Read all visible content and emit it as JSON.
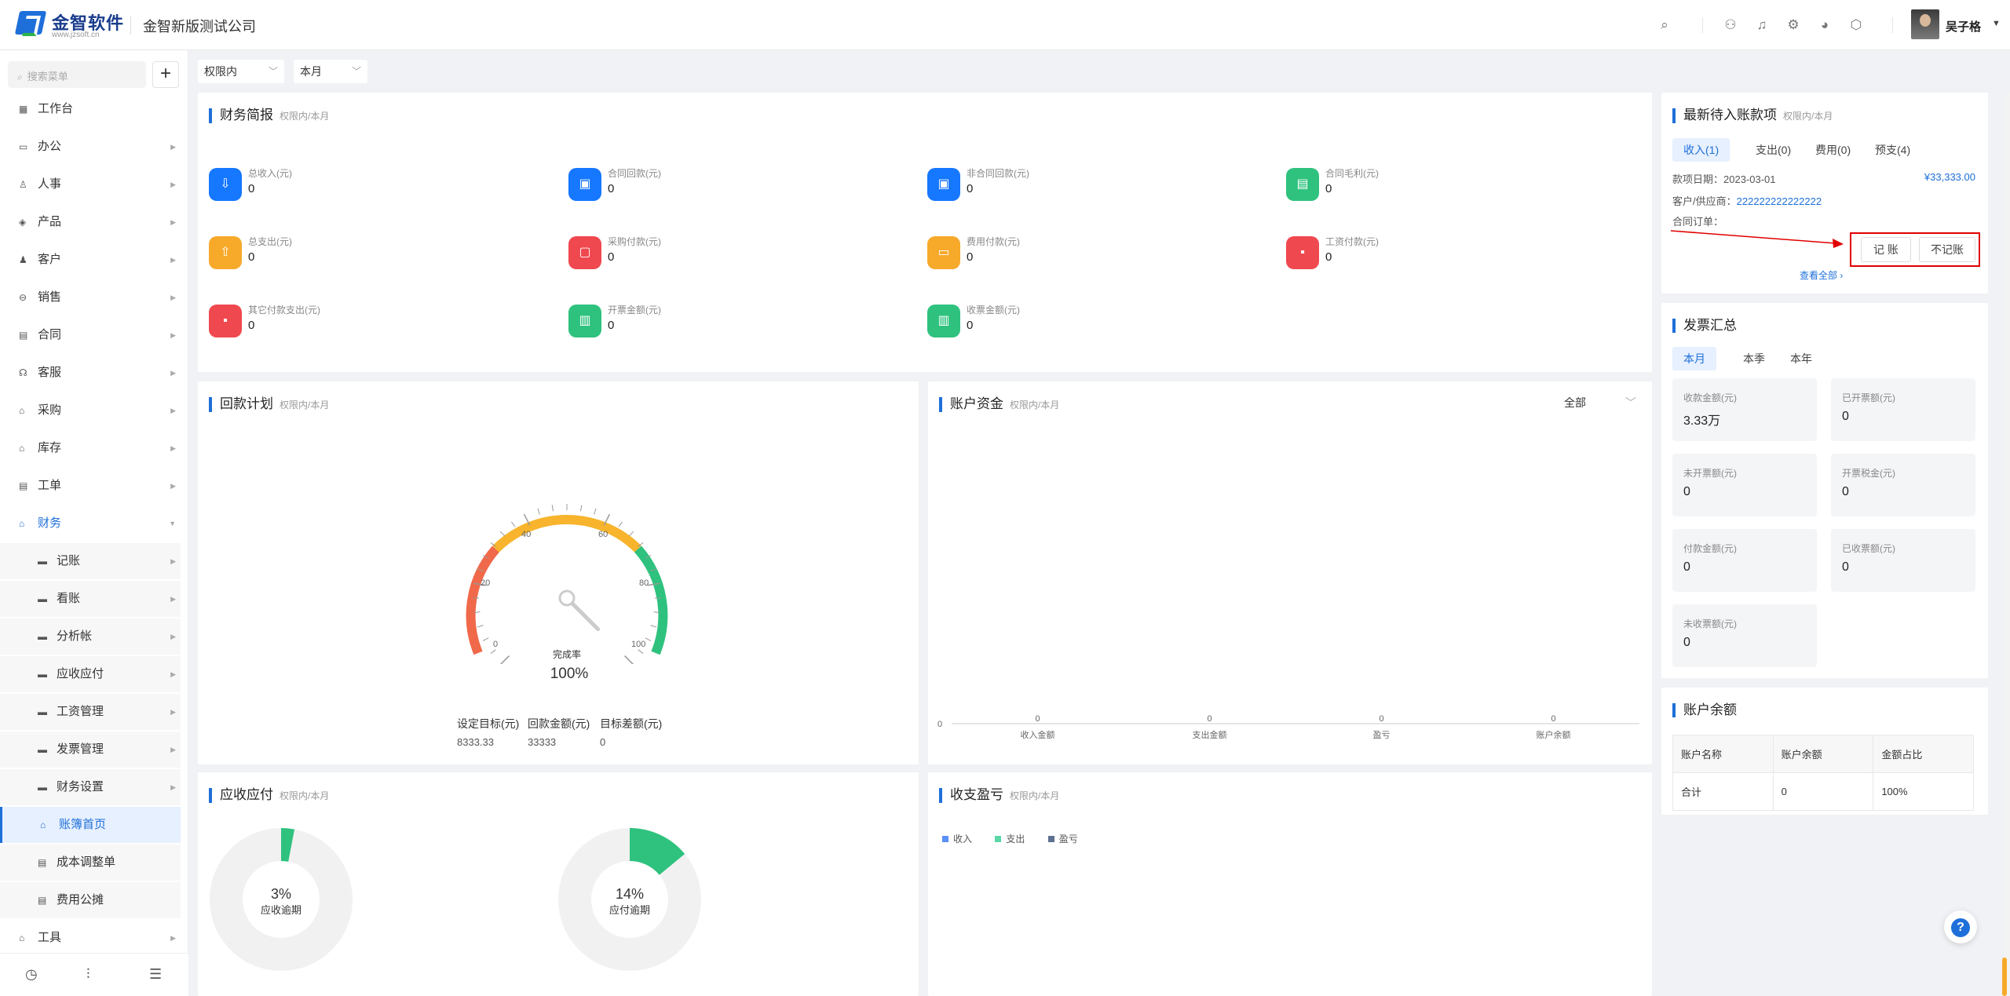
{
  "header": {
    "logo_title": "金智软件",
    "logo_url": "www.jzsoft.cn",
    "company": "金智新版测试公司",
    "user_name": "吴子格"
  },
  "sidebar": {
    "search_placeholder": "搜索菜单",
    "add_label": "+",
    "items": [
      {
        "label": "工作台",
        "icon": "dashboard-icon"
      },
      {
        "label": "办公",
        "icon": "office-icon"
      },
      {
        "label": "人事",
        "icon": "people-icon"
      },
      {
        "label": "产品",
        "icon": "product-icon"
      },
      {
        "label": "客户",
        "icon": "customer-icon"
      },
      {
        "label": "销售",
        "icon": "sales-icon"
      },
      {
        "label": "合同",
        "icon": "contract-icon"
      },
      {
        "label": "客服",
        "icon": "service-icon"
      },
      {
        "label": "采购",
        "icon": "purchase-icon"
      },
      {
        "label": "库存",
        "icon": "inventory-icon"
      },
      {
        "label": "工单",
        "icon": "ticket-icon"
      },
      {
        "label": "财务",
        "icon": "finance-icon"
      }
    ],
    "finance_sub": [
      {
        "label": "记账"
      },
      {
        "label": "看账"
      },
      {
        "label": "分析帐"
      },
      {
        "label": "应收应付"
      },
      {
        "label": "工资管理"
      },
      {
        "label": "发票管理"
      },
      {
        "label": "财务设置"
      },
      {
        "label": "账簿首页"
      },
      {
        "label": "成本调整单"
      },
      {
        "label": "费用公摊"
      }
    ],
    "tools": "工具"
  },
  "filters": {
    "scope": "权限内",
    "period": "本月"
  },
  "finance_brief": {
    "title": "财务简报",
    "sub": "权限内/本月",
    "items": [
      {
        "label": "总收入(元)",
        "value": "0"
      },
      {
        "label": "合同回款(元)",
        "value": "0"
      },
      {
        "label": "非合同回款(元)",
        "value": "0"
      },
      {
        "label": "合同毛利(元)",
        "value": "0"
      },
      {
        "label": "总支出(元)",
        "value": "0"
      },
      {
        "label": "采购付款(元)",
        "value": "0"
      },
      {
        "label": "费用付款(元)",
        "value": "0"
      },
      {
        "label": "工资付款(元)",
        "value": "0"
      },
      {
        "label": "其它付款支出(元)",
        "value": "0"
      },
      {
        "label": "开票金额(元)",
        "value": "0"
      },
      {
        "label": "收票金额(元)",
        "value": "0"
      }
    ],
    "colors": {
      "blue": "#1677ff",
      "orange": "#f7a92a",
      "red": "#f0484f",
      "green": "#2ec27e"
    }
  },
  "payment_plan": {
    "title": "回款计划",
    "sub": "权限内/本月",
    "gauge_ticks": [
      "0",
      "20",
      "40",
      "60",
      "80",
      "100"
    ],
    "gauge_label": "完成率",
    "gauge_value": "100%",
    "gauge_fraction": 1.0,
    "stats": [
      {
        "label": "设定目标(元)",
        "value": "8333.33"
      },
      {
        "label": "回款金额(元)",
        "value": "33333"
      },
      {
        "label": "目标差额(元)",
        "value": "0"
      }
    ]
  },
  "account_funds": {
    "title": "账户资金",
    "sub": "权限内/本月",
    "select": "全部"
  },
  "chart_data": {
    "type": "bar",
    "categories": [
      "收入金额",
      "支出金额",
      "盈亏",
      "账户余额"
    ],
    "values": [
      0,
      0,
      0,
      0
    ],
    "y_tick": "0"
  },
  "receivable": {
    "title": "应收应付",
    "sub": "权限内/本月",
    "donuts": [
      {
        "pct": "3%",
        "label": "应收逾期",
        "fraction": 0.03
      },
      {
        "pct": "14%",
        "label": "应付逾期",
        "fraction": 0.14
      }
    ]
  },
  "profit_loss": {
    "title": "收支盈亏",
    "sub": "权限内/本月",
    "legend": [
      {
        "label": "收入",
        "color": "#5b8ff9"
      },
      {
        "label": "支出",
        "color": "#5ad8a6"
      },
      {
        "label": "盈亏",
        "color": "#5d7092"
      }
    ]
  },
  "pending": {
    "title": "最新待入账款项",
    "sub": "权限内/本月",
    "tabs": [
      "收入(1)",
      "支出(0)",
      "费用(0)",
      "预支(4)"
    ],
    "date_label": "款项日期：2023-03-01",
    "amount": "¥33,333.00",
    "party_label": "客户/供应商：",
    "party_value": "222222222222222",
    "order_label": "合同订单：",
    "btn_record": "记 账",
    "btn_norecord": "不记账",
    "view_all": "查看全部 ›"
  },
  "invoice": {
    "title": "发票汇总",
    "tabs": [
      "本月",
      "本季",
      "本年"
    ],
    "stats": [
      {
        "label": "收款金额(元)",
        "value": "3.33万"
      },
      {
        "label": "已开票额(元)",
        "value": "0"
      },
      {
        "label": "未开票额(元)",
        "value": "0"
      },
      {
        "label": "开票税金(元)",
        "value": "0"
      },
      {
        "label": "付款金额(元)",
        "value": "0"
      },
      {
        "label": "已收票额(元)",
        "value": "0"
      },
      {
        "label": "未收票额(元)",
        "value": "0"
      }
    ]
  },
  "balance": {
    "title": "账户余额",
    "headers": [
      "账户名称",
      "账户余额",
      "金额占比"
    ],
    "row": [
      "合计",
      "0",
      "100%"
    ]
  },
  "help": "?"
}
